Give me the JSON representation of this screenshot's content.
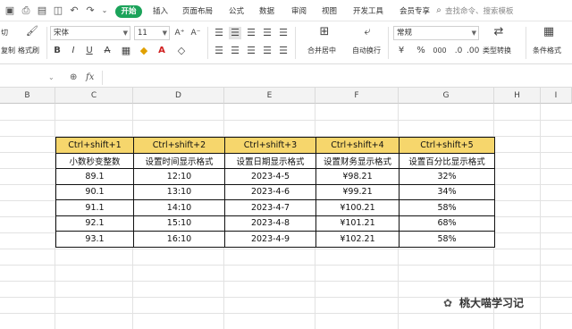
{
  "menu": {
    "start": "开始",
    "items": [
      "插入",
      "页面布局",
      "公式",
      "数据",
      "审阅",
      "视图",
      "开发工具",
      "会员专享"
    ],
    "search_placeholder": "查找命令、搜索模板"
  },
  "ribbon": {
    "cut_label": "切",
    "copy_label": "复制",
    "format_painter": "格式刷",
    "font_name": "宋体",
    "font_size": "11",
    "bold": "B",
    "italic": "I",
    "underline": "U",
    "merge_center": "合并居中",
    "wrap_text": "自动换行",
    "number_format": "常规",
    "currency": "¥",
    "percent": "%",
    "comma": "000",
    "type_convert": "类型转换",
    "conditional_format": "条件格式"
  },
  "formula_bar": {
    "name_box": "",
    "fx": "fx",
    "value": ""
  },
  "columns": [
    "B",
    "C",
    "D",
    "E",
    "F",
    "G",
    "H",
    "I"
  ],
  "table": {
    "headers": [
      "Ctrl+shift+1",
      "Ctrl+shift+2",
      "Ctrl+shift+3",
      "Ctrl+shift+4",
      "Ctrl+shift+5"
    ],
    "descriptions": [
      "小数秒变整数",
      "设置时间显示格式",
      "设置日期显示格式",
      "设置财务显示格式",
      "设置百分比显示格式"
    ],
    "rows": [
      [
        "89.1",
        "12:10",
        "2023-4-5",
        "¥98.21",
        "32%"
      ],
      [
        "90.1",
        "13:10",
        "2023-4-6",
        "¥99.21",
        "34%"
      ],
      [
        "91.1",
        "14:10",
        "2023-4-7",
        "¥100.21",
        "58%"
      ],
      [
        "92.1",
        "15:10",
        "2023-4-8",
        "¥101.21",
        "68%"
      ],
      [
        "93.1",
        "16:10",
        "2023-4-9",
        "¥102.21",
        "58%"
      ]
    ]
  },
  "watermark": "桃大喵学习记",
  "colors": {
    "start_tab": "#1ba35a",
    "header_fill": "#f6d66c",
    "grid_line": "#e2e2e2"
  }
}
